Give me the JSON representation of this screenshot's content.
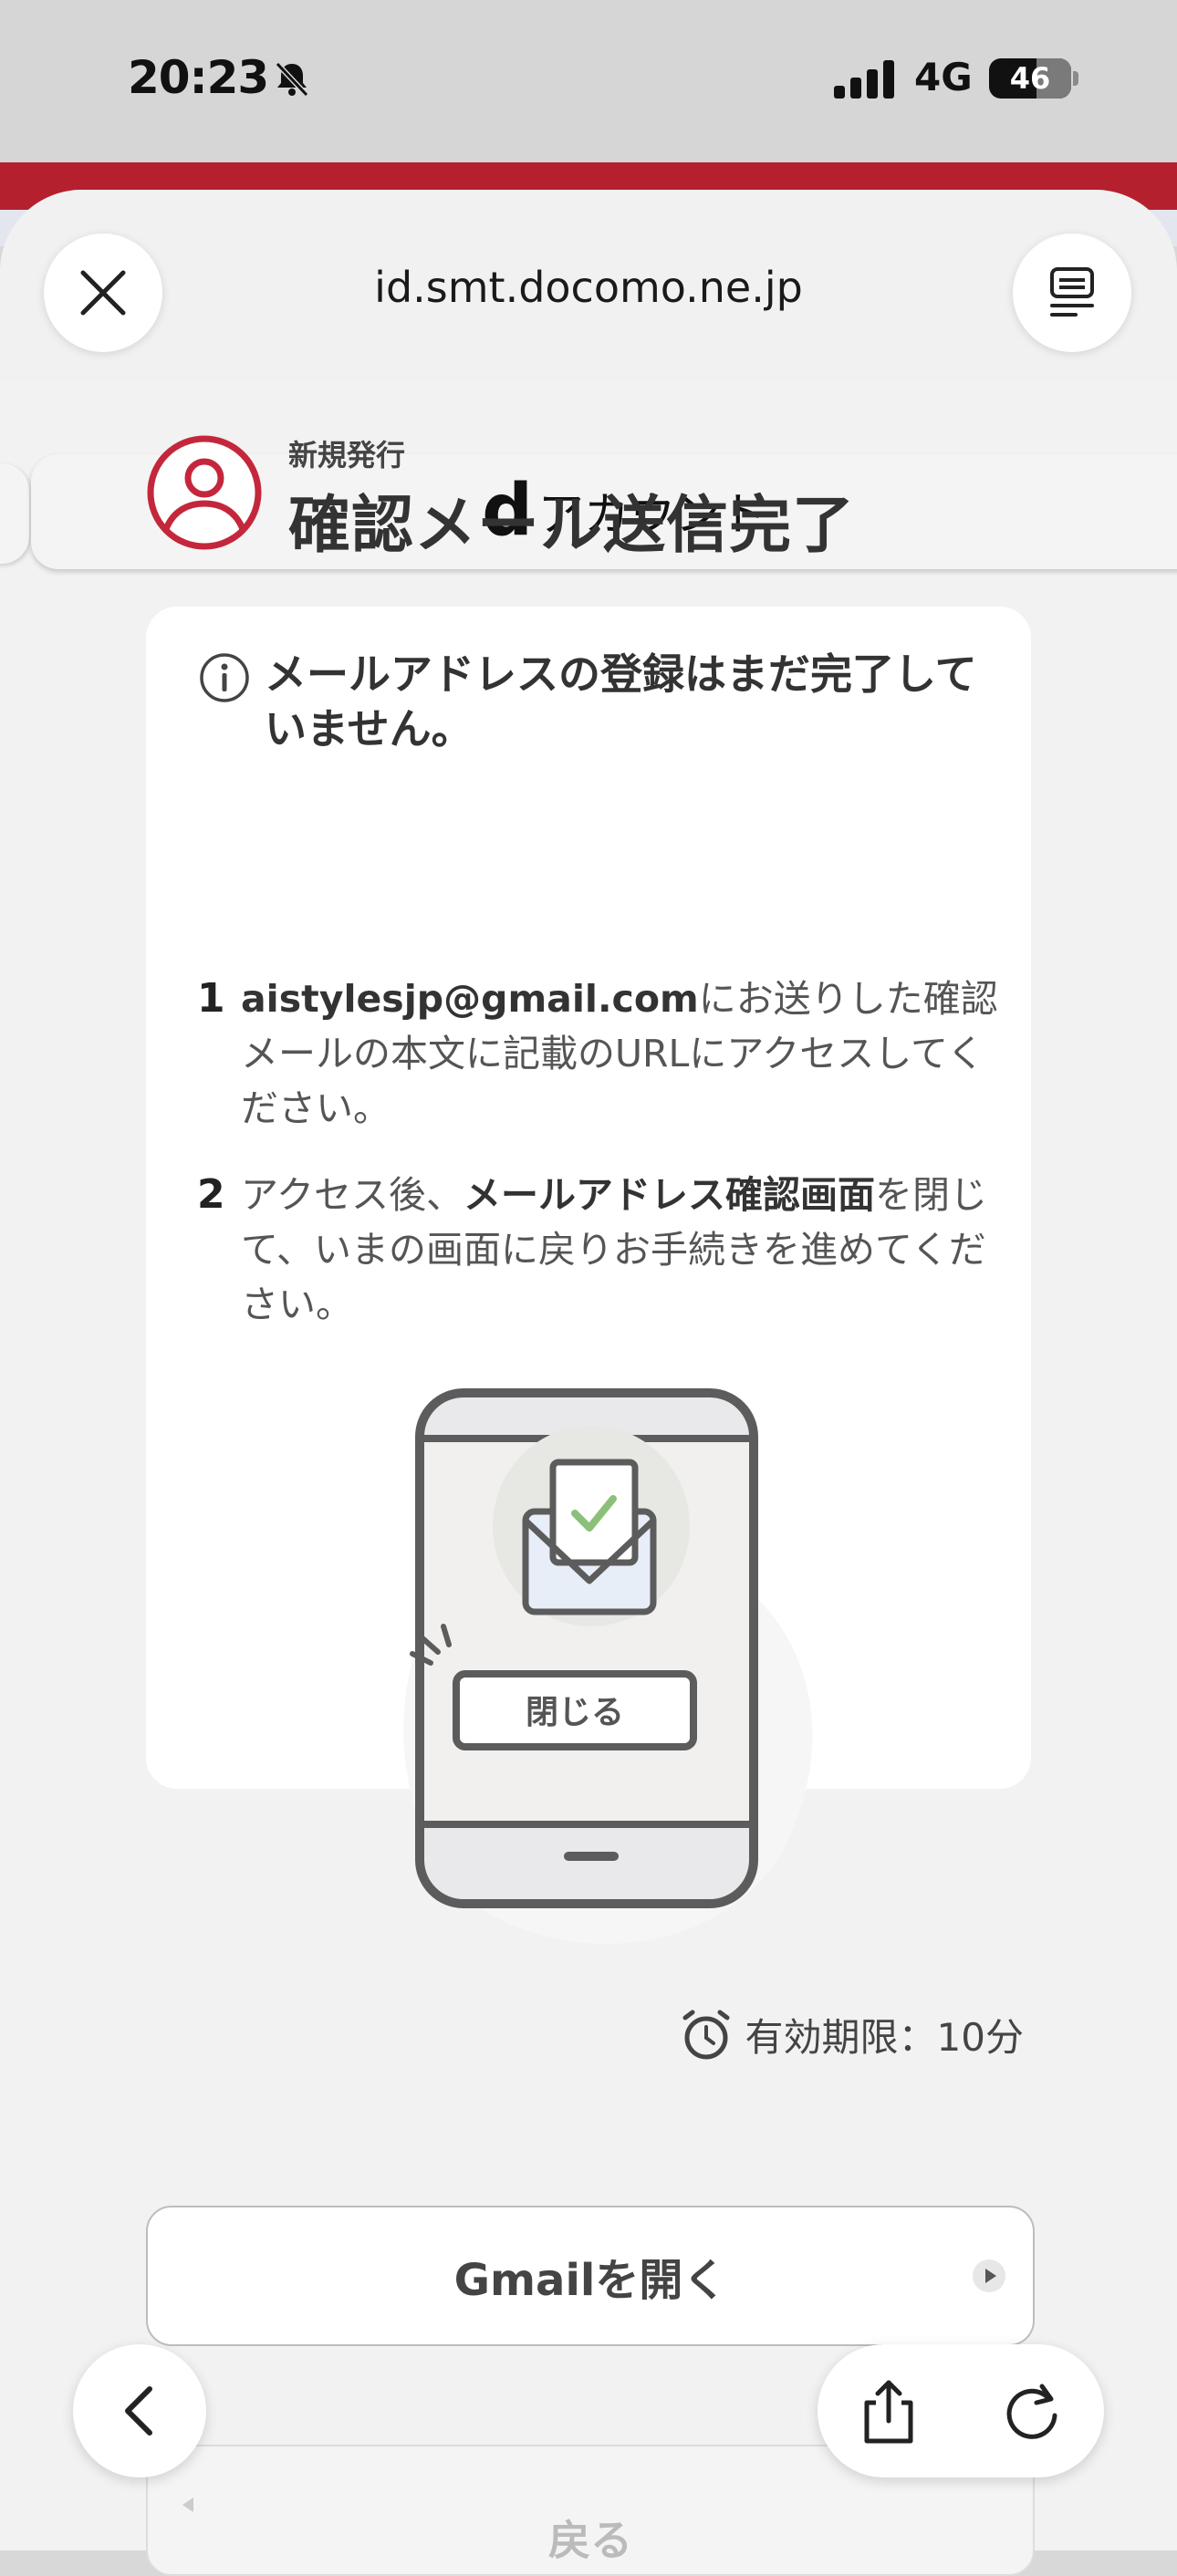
{
  "status_bar": {
    "time": "20:23",
    "network": "4G",
    "battery": "46",
    "icons": [
      "bell-muted-icon",
      "signal-icon",
      "battery-icon"
    ]
  },
  "browser": {
    "url": "id.smt.docomo.ne.jp",
    "icons": [
      "close-icon",
      "reader-icon",
      "back-icon",
      "share-icon",
      "reload-icon"
    ]
  },
  "site": {
    "logo_letter": "d",
    "logo_text": "アカウント"
  },
  "heading": {
    "sub": "新規発行",
    "title": "確認メール送信完了"
  },
  "card": {
    "notice": "メールアドレスの登録はまだ完了していません。",
    "steps": [
      {
        "num": "1",
        "bold": "aistylesjp@gmail.com",
        "text": "にお送りした確認メールの本文に記載のURLにアクセスしてください。"
      },
      {
        "num": "2",
        "pre": "アクセス後、",
        "bold": "メールアドレス確認画面",
        "post": "を閉じて、いまの画面に戻りお手続きを進めてください。"
      }
    ],
    "illustration_button": "閉じる"
  },
  "expiry": {
    "label": "有効期限：10分"
  },
  "buttons": {
    "open_gmail": "Gmailを開く",
    "back": "戻る"
  },
  "colors": {
    "accent_red": "#c4273c",
    "check_green": "#8cc07a"
  }
}
